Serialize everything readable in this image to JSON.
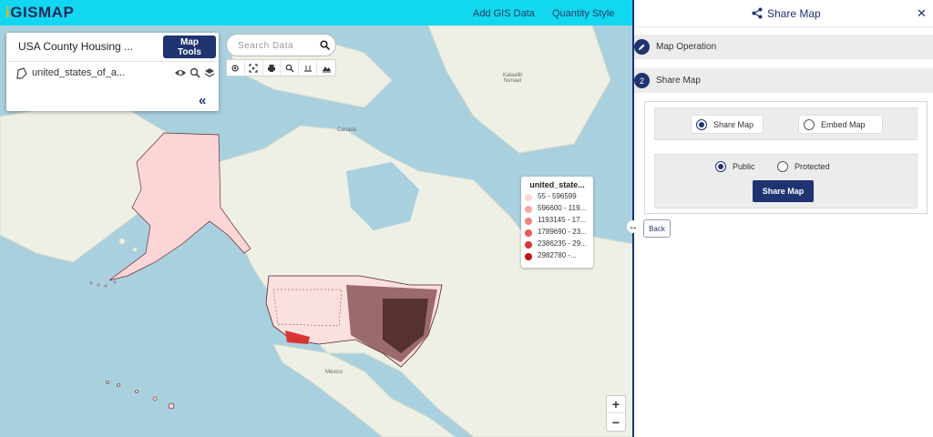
{
  "header": {
    "logo_prefix": "i",
    "logo_text": "GISMAP",
    "nav": [
      "Add GIS Data",
      "Quantity Style"
    ]
  },
  "layer_panel": {
    "title": "USA County Housing ...",
    "map_tools_label": "Map Tools",
    "layer_name": "united_states_of_a..."
  },
  "search": {
    "placeholder": "Search Data"
  },
  "legend": {
    "title": "united_state...",
    "items": [
      {
        "label": "55 - 596599",
        "color": "#fcd6d6"
      },
      {
        "label": "596600 - 119...",
        "color": "#f7a6a6"
      },
      {
        "label": "1193145 - 17...",
        "color": "#f08080"
      },
      {
        "label": "1789690 - 23...",
        "color": "#e65a5a"
      },
      {
        "label": "2386235 - 29...",
        "color": "#d93434"
      },
      {
        "label": "2982780 -...",
        "color": "#c41111"
      }
    ]
  },
  "map_labels": {
    "canada": "Canada",
    "mexico": "México",
    "greenland": "Kalaallit\nNunaat"
  },
  "back_label": "Back",
  "right_panel": {
    "title": "Share Map",
    "sections": [
      {
        "badge": "",
        "label": "Map Operation"
      },
      {
        "badge": "2",
        "label": "Share Map"
      }
    ],
    "mode_options": {
      "selected": "Share Map",
      "share_map": "Share Map",
      "embed_map": "Embed Map"
    },
    "access_options": {
      "selected": "Public",
      "public": "Public",
      "protected": "Protected"
    },
    "share_button": "Share Map"
  },
  "colors": {
    "accent": "#1f3370",
    "topbar": "#11d8f0",
    "water": "#a9d0df",
    "land": "#eef0e6"
  }
}
